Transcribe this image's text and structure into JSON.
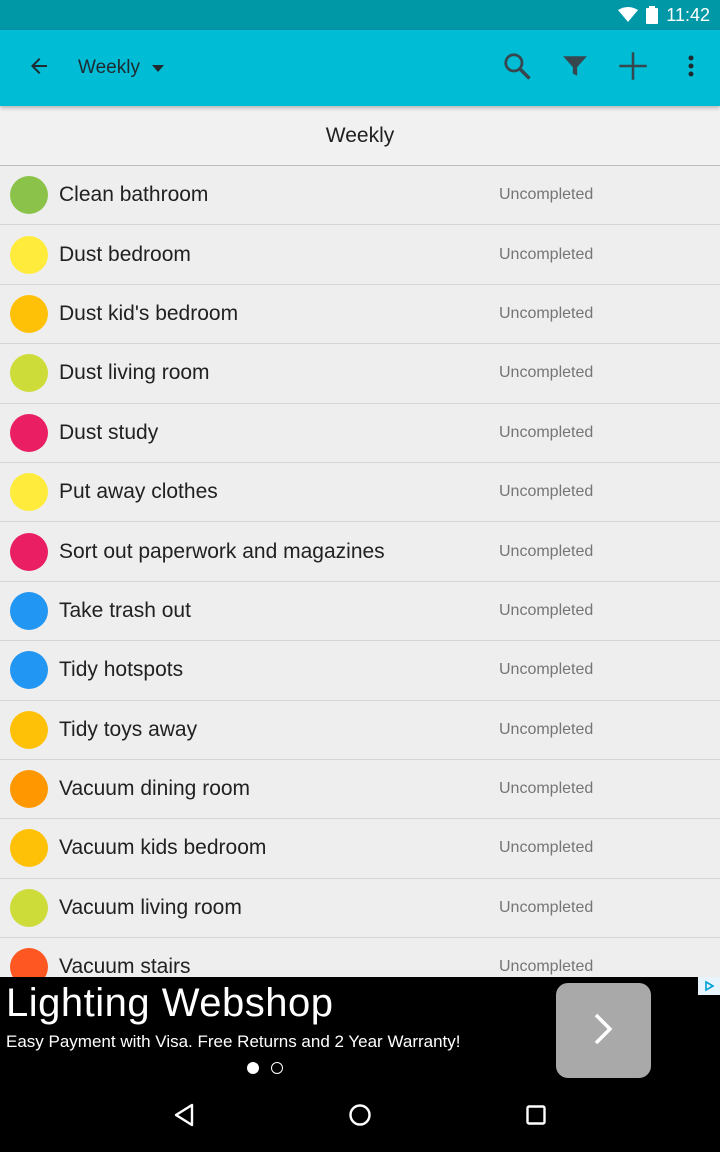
{
  "status_bar": {
    "time": "11:42",
    "icons": [
      "wifi-icon",
      "battery-icon"
    ]
  },
  "toolbar": {
    "title": "Weekly",
    "icons": [
      "back-arrow-icon",
      "dropdown-caret-icon",
      "search-icon",
      "filter-icon",
      "add-icon",
      "overflow-menu-icon"
    ]
  },
  "list_header": "Weekly",
  "colors": {
    "toolbar": "#00bcd4",
    "status_bar": "#0097a7",
    "green": "#8bc34a",
    "yellow": "#ffeb3b",
    "amber": "#ffc107",
    "lime": "#cddc39",
    "pink": "#e91e63",
    "blue": "#2196f3",
    "orange": "#ff9800",
    "deep_orange": "#ff5722"
  },
  "tasks": [
    {
      "name": "Clean bathroom",
      "status": "Uncompleted",
      "color": "#8bc34a"
    },
    {
      "name": "Dust bedroom",
      "status": "Uncompleted",
      "color": "#ffeb3b"
    },
    {
      "name": "Dust kid's bedroom",
      "status": "Uncompleted",
      "color": "#ffc107"
    },
    {
      "name": "Dust living room",
      "status": "Uncompleted",
      "color": "#cddc39"
    },
    {
      "name": "Dust study",
      "status": "Uncompleted",
      "color": "#e91e63"
    },
    {
      "name": "Put away clothes",
      "status": "Uncompleted",
      "color": "#ffeb3b"
    },
    {
      "name": "Sort out paperwork and magazines",
      "status": "Uncompleted",
      "color": "#e91e63"
    },
    {
      "name": "Take trash out",
      "status": "Uncompleted",
      "color": "#2196f3"
    },
    {
      "name": "Tidy hotspots",
      "status": "Uncompleted",
      "color": "#2196f3"
    },
    {
      "name": "Tidy toys away",
      "status": "Uncompleted",
      "color": "#ffc107"
    },
    {
      "name": "Vacuum dining room",
      "status": "Uncompleted",
      "color": "#ff9800"
    },
    {
      "name": "Vacuum kids bedroom",
      "status": "Uncompleted",
      "color": "#ffc107"
    },
    {
      "name": "Vacuum living room",
      "status": "Uncompleted",
      "color": "#cddc39"
    },
    {
      "name": "Vacuum stairs",
      "status": "Uncompleted",
      "color": "#ff5722"
    }
  ],
  "ad": {
    "title": "Lighting Webshop",
    "subtitle": "Easy Payment with Visa. Free Returns and 2 Year Warranty!",
    "icons": [
      "chevron-right-icon",
      "ad-choices-icon"
    ]
  },
  "nav_bar": {
    "icons": [
      "back-triangle-icon",
      "home-circle-icon",
      "recents-square-icon"
    ]
  }
}
